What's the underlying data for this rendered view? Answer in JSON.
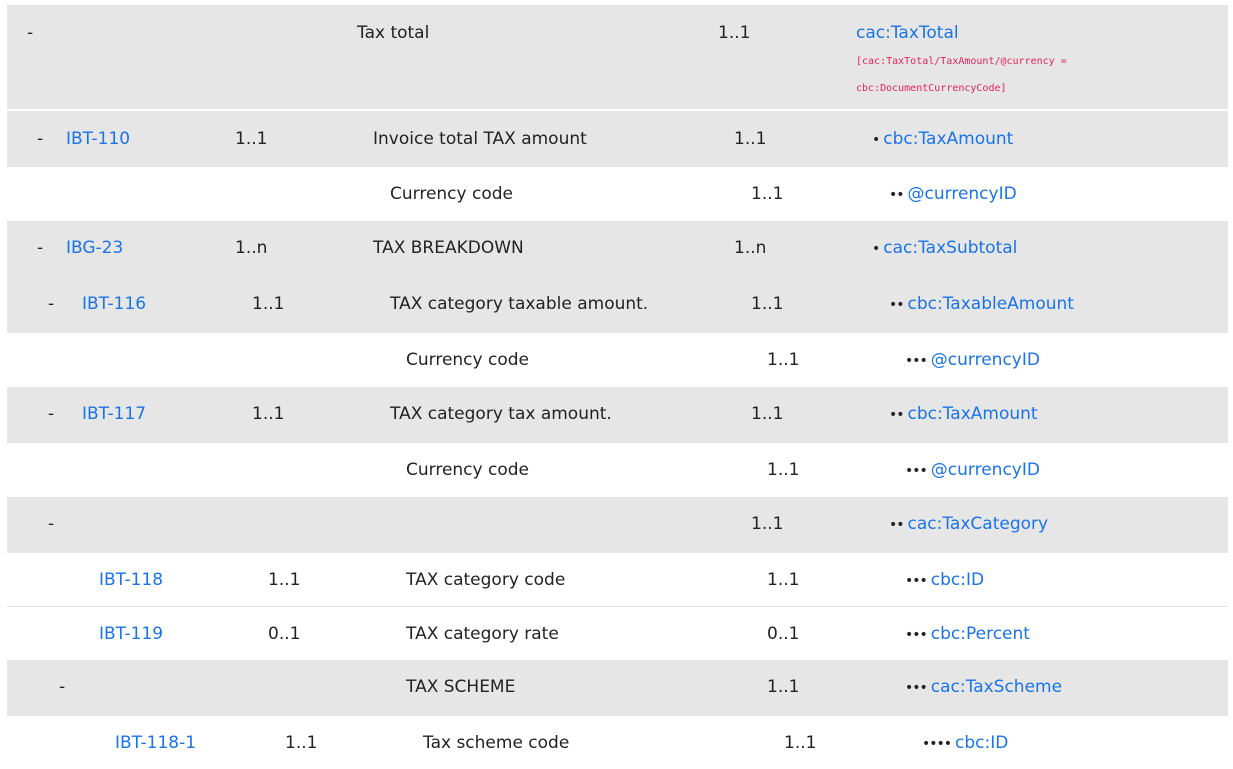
{
  "rows": [
    {
      "toggle": "-",
      "bt": "",
      "card": "",
      "name": "Tax total",
      "ubl_card": "1..1",
      "dots": "",
      "path": "cac:TaxTotal",
      "note": [
        "[cac:TaxTotal/TaxAmount/@currency =",
        "cbc:DocumentCurrencyCode]"
      ]
    },
    {
      "toggle": "-",
      "bt": "IBT-110",
      "card": "1..1",
      "name": "Invoice total TAX amount",
      "ubl_card": "1..1",
      "dots": "•",
      "path": "cbc:TaxAmount"
    },
    {
      "toggle": "",
      "bt": "",
      "card": "",
      "name": "Currency code",
      "ubl_card": "1..1",
      "dots": "••",
      "path": "@currencyID"
    },
    {
      "toggle": "-",
      "bt": "IBG-23",
      "card": "1..n",
      "name": "TAX BREAKDOWN",
      "ubl_card": "1..n",
      "dots": "•",
      "path": "cac:TaxSubtotal"
    },
    {
      "toggle": "-",
      "bt": "IBT-116",
      "card": "1..1",
      "name": "TAX category taxable amount.",
      "ubl_card": "1..1",
      "dots": "••",
      "path": "cbc:TaxableAmount"
    },
    {
      "toggle": "",
      "bt": "",
      "card": "",
      "name": "Currency code",
      "ubl_card": "1..1",
      "dots": "•••",
      "path": "@currencyID"
    },
    {
      "toggle": "-",
      "bt": "IBT-117",
      "card": "1..1",
      "name": "TAX category tax amount.",
      "ubl_card": "1..1",
      "dots": "••",
      "path": "cbc:TaxAmount"
    },
    {
      "toggle": "",
      "bt": "",
      "card": "",
      "name": "Currency code",
      "ubl_card": "1..1",
      "dots": "•••",
      "path": "@currencyID"
    },
    {
      "toggle": "-",
      "bt": "",
      "card": "",
      "name": "",
      "ubl_card": "1..1",
      "dots": "••",
      "path": "cac:TaxCategory"
    },
    {
      "toggle": "",
      "bt": "IBT-118",
      "card": "1..1",
      "name": "TAX category code",
      "ubl_card": "1..1",
      "dots": "•••",
      "path": "cbc:ID"
    },
    {
      "toggle": "",
      "bt": "IBT-119",
      "card": "0..1",
      "name": "TAX category rate",
      "ubl_card": "0..1",
      "dots": "•••",
      "path": "cbc:Percent"
    },
    {
      "toggle": "-",
      "bt": "",
      "card": "",
      "name": "TAX SCHEME",
      "ubl_card": "1..1",
      "dots": "•••",
      "path": "cac:TaxScheme"
    },
    {
      "toggle": "",
      "bt": "IBT-118-1",
      "card": "1..1",
      "name": "Tax scheme code",
      "ubl_card": "1..1",
      "dots": "••••",
      "path": "cbc:ID"
    }
  ]
}
